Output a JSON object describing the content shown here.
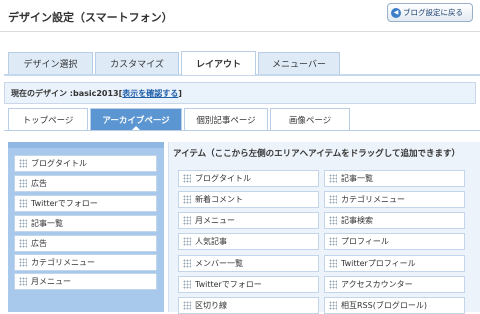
{
  "header": {
    "title": "デザイン設定（スマートフォン）",
    "back_button": "ブログ設定に戻る",
    "back_icon": "back-arrow-icon"
  },
  "main_tabs": [
    {
      "label": "デザイン選択",
      "active": false
    },
    {
      "label": "カスタマイズ",
      "active": false
    },
    {
      "label": "レイアウト",
      "active": true
    },
    {
      "label": "メニューバー",
      "active": false
    }
  ],
  "current_design": {
    "prefix": "現在のデザイン : ",
    "name": "basic2013",
    "link_open": "[",
    "link": "表示を確認する",
    "link_close": "]"
  },
  "sub_tabs": [
    {
      "label": "トップページ",
      "active": false
    },
    {
      "label": "アーカイブページ",
      "active": true
    },
    {
      "label": "個別記事ページ",
      "active": false
    },
    {
      "label": "画像ページ",
      "active": false
    }
  ],
  "layout_items": [
    "ブログタイトル",
    "広告",
    "Twitterでフォロー",
    "記事一覧",
    "広告",
    "カテゴリメニュー",
    "月メニュー"
  ],
  "items_panel": {
    "header": "アイテム（ここから左側のエリアへアイテムをドラッグして追加できます）",
    "left_column": [
      "ブログタイトル",
      "新着コメント",
      "月メニュー",
      "人気記事",
      "メンバー一覧",
      "Twitterでフォロー",
      "区切り線"
    ],
    "right_column": [
      "記事一覧",
      "カテゴリメニュー",
      "記事検索",
      "プロフィール",
      "Twitterプロフィール",
      "アクセスカウンター",
      "相互RSS(ブログロール)"
    ]
  },
  "colors": {
    "accent": "#5b95d2",
    "tab_bg": "#dfeaf7",
    "left_panel": "#a8c9ec",
    "link": "#1f5fa8"
  }
}
